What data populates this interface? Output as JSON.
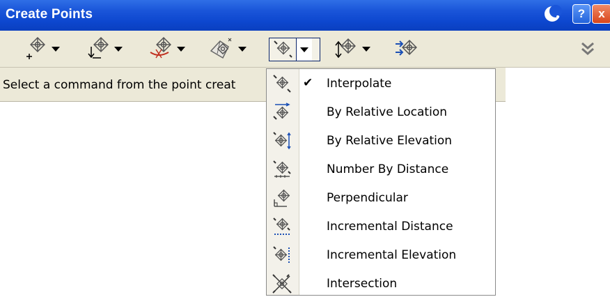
{
  "window": {
    "title": "Create Points",
    "help_label": "?",
    "close_label": "x"
  },
  "toolbar": {
    "tools": [
      {
        "icon": "point-add-icon"
      },
      {
        "icon": "point-import-icon"
      },
      {
        "icon": "point-alignment-icon"
      },
      {
        "icon": "point-surface-icon"
      },
      {
        "icon": "point-interpolate-icon",
        "active": true
      },
      {
        "icon": "point-slope-icon"
      },
      {
        "icon": "point-convert-icon"
      }
    ],
    "expand_icon": "double-chevron-down-icon"
  },
  "prompt": {
    "text": "Select a command from the point creat"
  },
  "menu": {
    "items": [
      {
        "label": "Interpolate",
        "checked": true,
        "check_glyph": "✔"
      },
      {
        "label": "By Relative Location",
        "checked": false
      },
      {
        "label": "By Relative Elevation",
        "checked": false
      },
      {
        "label": "Number By Distance",
        "checked": false
      },
      {
        "label": "Perpendicular",
        "checked": false
      },
      {
        "label": "Incremental Distance",
        "checked": false
      },
      {
        "label": "Incremental Elevation",
        "checked": false
      },
      {
        "label": "Intersection",
        "checked": false
      }
    ]
  },
  "colors": {
    "titlebar": "#0d47cf",
    "toolbar": "#ece9d8",
    "accent": "#0a246a"
  }
}
